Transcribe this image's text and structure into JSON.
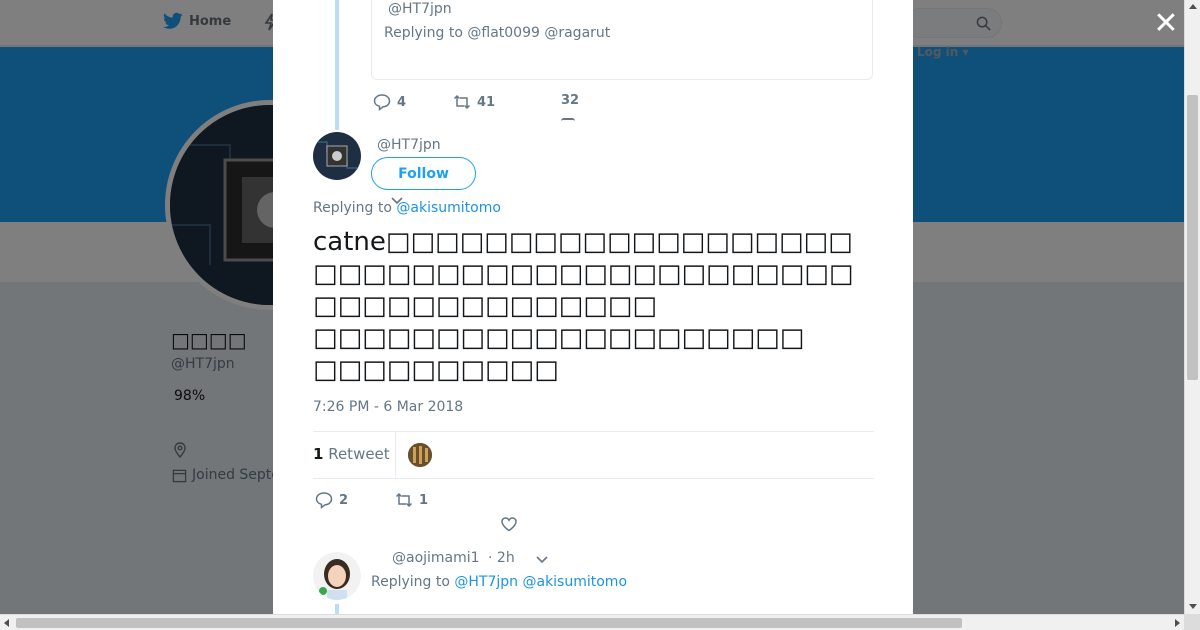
{
  "topbar": {
    "home_label": "Home",
    "login_label": "Log in ▾"
  },
  "profile": {
    "name": "□□□□",
    "handle": "@HT7jpn",
    "percent": "98%",
    "joined": "Joined Septe"
  },
  "modal": {
    "close_symbol": "✕",
    "prev_tweet": {
      "handle": "@HT7jpn",
      "replying": "Replying to @flat0099 @ragarut",
      "replies": "4",
      "retweets": "41",
      "likes": "32"
    },
    "main_tweet": {
      "handle": "@HT7jpn",
      "follow_label": "Follow",
      "replying_prefix": "Replying to ",
      "replying_mention": "@akisumitomo",
      "text": "catne□□□□□□□□□□□□□□□□□□□□□□□□□□□□□□□□\n□□□□□□□□□□□□□□□□□□□□□□□□□□□□□□□□□□\n□□□□□□□□□□□□□□\n□□□□□□□□□□□□□□□□□□□□\n□□□□□□□□□□",
      "timestamp": "7:26 PM - 6 Mar 2018",
      "retweet_count": "1",
      "retweet_label": " Retweet",
      "replies": "2",
      "retweets": "1"
    },
    "reply_tweet": {
      "handle": "@aojimami1",
      "time": "· 2h",
      "replying_prefix": "Replying to ",
      "mention_1": "@HT7jpn",
      "mention_2": "@akisumitomo"
    }
  },
  "colors": {
    "accent": "#1da1f2",
    "text_secondary": "#657786",
    "thread_line": "#bcdcf4"
  }
}
